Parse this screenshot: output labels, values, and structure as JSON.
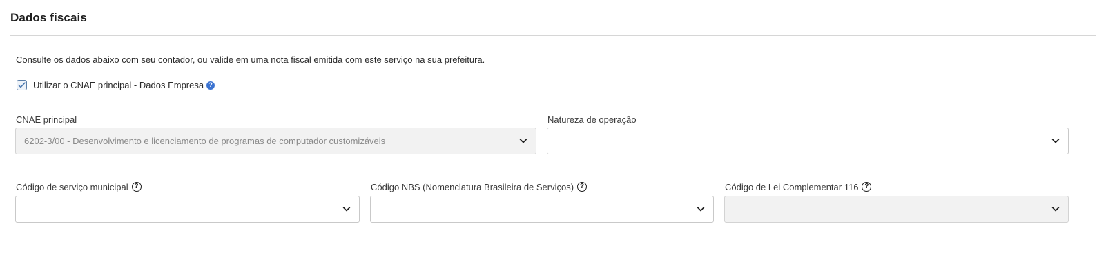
{
  "section": {
    "title": "Dados fiscais",
    "intro": "Consulte os dados abaixo com seu contador, ou valide em uma nota fiscal emitida com este serviço na sua prefeitura."
  },
  "cnae_checkbox": {
    "label": "Utilizar o CNAE principal - Dados Empresa",
    "checked": true,
    "help_icon": "question-circle-icon"
  },
  "fields": {
    "cnae_principal": {
      "label": "CNAE principal",
      "value": "6202-3/00 - Desenvolvimento e licenciamento de programas de computador customizáveis",
      "disabled": true
    },
    "natureza_operacao": {
      "label": "Natureza de operação",
      "value": ""
    },
    "codigo_servico_municipal": {
      "label": "Código de serviço municipal",
      "value": ""
    },
    "codigo_nbs": {
      "label": "Código NBS (Nomenclatura Brasileira de Serviços)",
      "value": ""
    },
    "codigo_lei_116": {
      "label": "Código de Lei Complementar 116",
      "value": "",
      "disabled": true
    }
  },
  "colors": {
    "accent_blue": "#3b73d1",
    "disabled_bg": "#f2f2f2",
    "border": "#c9c9c9"
  }
}
